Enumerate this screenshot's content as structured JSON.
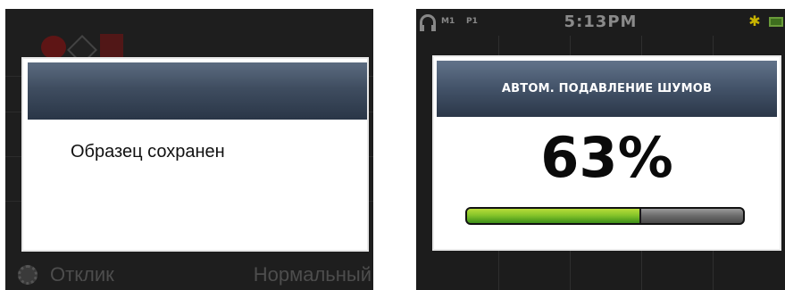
{
  "left_screen": {
    "dialog": {
      "title": "",
      "message": "Образец сохранен"
    },
    "footer": {
      "setting_label": "Отклик",
      "setting_value": "Нормальный"
    }
  },
  "right_screen": {
    "status_bar": {
      "mode_1": "M1",
      "mode_2": "P1",
      "time": "5:13PM",
      "icons": [
        "headphones-icon",
        "backlight-icon",
        "battery-icon"
      ]
    },
    "dialog": {
      "title": "АВТОМ. ПОДАВЛЕНИЕ ШУМОВ",
      "percent_text": "63%",
      "progress_fraction": 0.63
    }
  },
  "colors": {
    "title_bar": "#45556b",
    "progress_fill": "#86c52a",
    "progress_track": "#6a6a6a",
    "screen_bg": "#1e1e1e"
  }
}
